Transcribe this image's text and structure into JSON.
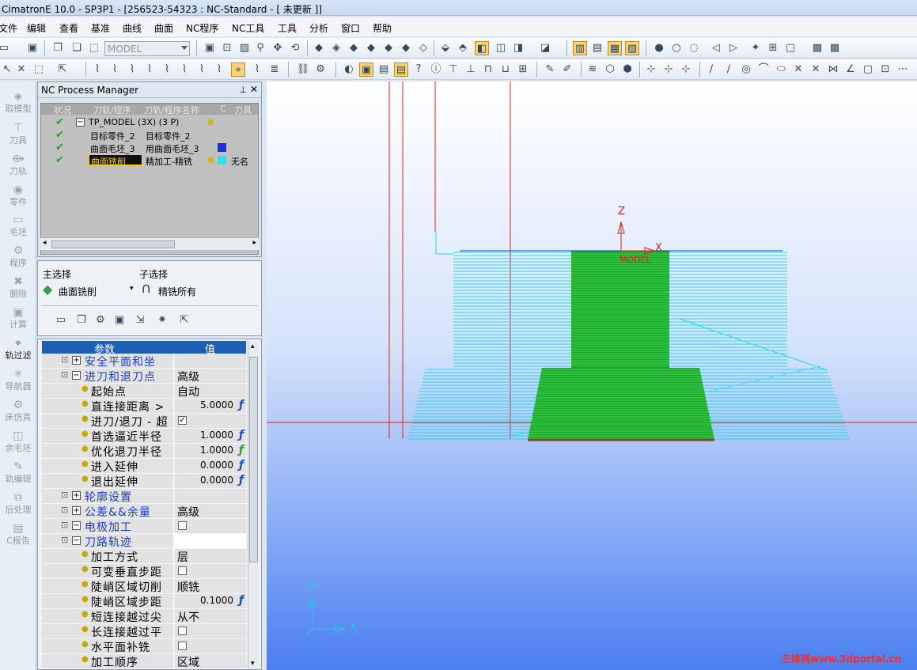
{
  "window_title": "CimatronE 10.0 - SP3P1 - [256523-54323 : NC-Standard - [ 未更新 ]]",
  "menu": [
    "文件",
    "编辑",
    "查看",
    "基准",
    "曲线",
    "曲面",
    "NC程序",
    "NC工具",
    "工具",
    "分析",
    "窗口",
    "帮助"
  ],
  "toolbar": {
    "model_value": "MODEL"
  },
  "left_strip": {
    "items": [
      "取模型",
      "刀具",
      "刀轨",
      "零件",
      "毛坯",
      "程序",
      "删除",
      "计算",
      "轨过滤",
      "导航器",
      "床仿真",
      "余毛坯",
      "轨编辑",
      "后处理",
      "C报告"
    ]
  },
  "nc_process_manager": {
    "title": "NC Process Manager",
    "columns": [
      "状况",
      "刀轨/程序",
      "刀轨/程序名称",
      "C",
      "刀具"
    ],
    "rows": [
      {
        "name": "TP_MODEL (3X) (3 P)",
        "extra": ""
      },
      {
        "name": "目标零件_2",
        "extra": "目标零件_2"
      },
      {
        "name": "曲面毛坯_3",
        "extra": "用曲面毛坯_3"
      },
      {
        "name": "曲面铣削",
        "extra": "精加工-精铣",
        "tool": "无名"
      }
    ]
  },
  "selection": {
    "main_label": "主选择",
    "sub_label": "子选择",
    "main_value": "曲面铣削",
    "sub_value": "精铣所有"
  },
  "params": {
    "header_param": "参数",
    "header_value": "值",
    "rows": [
      {
        "label": "安全平面和坐",
        "value": ""
      },
      {
        "label": "进刀和退刀点",
        "value": "高级"
      },
      {
        "label": "起始点",
        "value": "自动"
      },
      {
        "label": "直连接距离 >",
        "value": "5.0000"
      },
      {
        "label": "进刀/退刀 - 超",
        "value": "✓"
      },
      {
        "label": "首选逼近半径",
        "value": "1.0000"
      },
      {
        "label": "优化退刀半径",
        "value": "1.0000"
      },
      {
        "label": "进入延伸",
        "value": "0.0000"
      },
      {
        "label": "退出延伸",
        "value": "0.0000"
      },
      {
        "label": "轮廓设置",
        "value": ""
      },
      {
        "label": "公差&&余量",
        "value": "高级"
      },
      {
        "label": "电极加工",
        "value": ""
      },
      {
        "label": "刀路轨迹",
        "value": ""
      },
      {
        "label": "加工方式",
        "value": "层"
      },
      {
        "label": "可变垂直步距",
        "value": ""
      },
      {
        "label": "陡峭区域切削",
        "value": "顺铣"
      },
      {
        "label": "陡峭区域步距",
        "value": "0.1000"
      },
      {
        "label": "短连接越过尖",
        "value": "从不"
      },
      {
        "label": "长连接越过平",
        "value": ""
      },
      {
        "label": "水平面补铣",
        "value": ""
      },
      {
        "label": "加工顺序",
        "value": "区域"
      }
    ]
  },
  "viewport": {
    "axis_z": "Z",
    "axis_x": "X",
    "model_label": "MODEL",
    "triad_z": "Z",
    "triad_x": "X"
  },
  "watermark": "三维网www.3dportal.cn"
}
